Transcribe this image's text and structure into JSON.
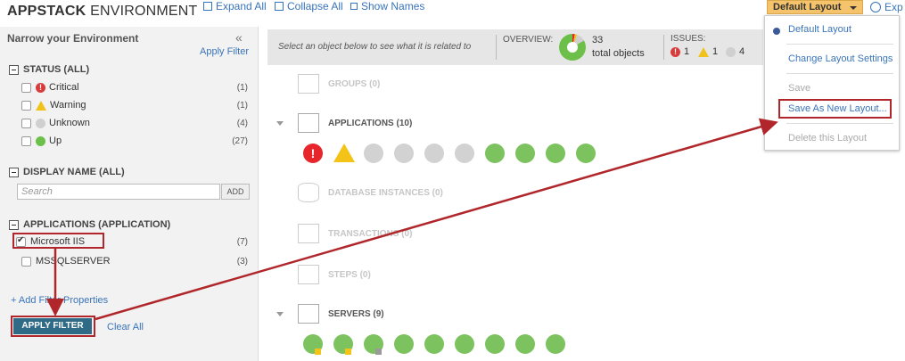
{
  "header": {
    "title_bold": "APPSTACK",
    "title_rest": " ENVIRONMENT",
    "links": {
      "expand_all": "Expand All",
      "collapse_all": "Collapse All",
      "show_names": "Show Names"
    },
    "layout_button": "Default Layout",
    "export_link": "Exp"
  },
  "sidebar": {
    "title": "Narrow your Environment",
    "collapse_glyph": "«",
    "apply_filter_link": "Apply Filter",
    "status": {
      "heading": "STATUS (ALL)",
      "items": [
        {
          "label": "Critical",
          "count": "(1)",
          "icon": "critical-icon"
        },
        {
          "label": "Warning",
          "count": "(1)",
          "icon": "warning-icon"
        },
        {
          "label": "Unknown",
          "count": "(4)",
          "icon": "unknown-icon"
        },
        {
          "label": "Up",
          "count": "(27)",
          "icon": "up-icon"
        }
      ]
    },
    "display_name": {
      "heading": "DISPLAY NAME (ALL)",
      "search_placeholder": "Search",
      "add_button": "ADD"
    },
    "applications": {
      "heading": "APPLICATIONS (APPLICATION)",
      "items": [
        {
          "label": "Microsoft IIS",
          "count": "(7)",
          "checked": true
        },
        {
          "label": "MSSQLSERVER",
          "count": "(3)",
          "checked": false
        }
      ]
    },
    "add_filter_properties": "+ Add Filter Properties",
    "apply_filter_button": "APPLY FILTER",
    "clear_all": "Clear All"
  },
  "overview": {
    "hint": "Select an object below to see what it is related to",
    "overview_label": "OVERVIEW:",
    "total_count": "33",
    "total_label": "total objects",
    "issues_label": "ISSUES:",
    "issue_counts": {
      "critical": "1",
      "warning": "1",
      "unknown": "4"
    }
  },
  "groups": [
    {
      "label": "GROUPS (0)",
      "icon": "folder-icon",
      "dim": true
    },
    {
      "label": "APPLICATIONS (10)",
      "icon": "window-icon",
      "dim": false
    },
    {
      "label": "DATABASE INSTANCES (0)",
      "icon": "database-icon",
      "dim": true
    },
    {
      "label": "TRANSACTIONS (0)",
      "icon": "tv-icon",
      "dim": true
    },
    {
      "label": "STEPS (0)",
      "icon": "film-icon",
      "dim": true
    },
    {
      "label": "SERVERS (9)",
      "icon": "server-icon",
      "dim": false
    }
  ],
  "applications_nodes": [
    "critical",
    "warning",
    "unknown",
    "unknown",
    "unknown",
    "unknown",
    "up",
    "up",
    "up",
    "up"
  ],
  "servers_nodes": [
    "up",
    "up",
    "up",
    "up",
    "up",
    "up",
    "up",
    "up",
    "up"
  ],
  "dropdown": {
    "items": [
      {
        "label": "Default Layout",
        "selected": true,
        "enabled": true
      },
      {
        "label": "Change Layout Settings",
        "enabled": true
      },
      {
        "label": "Save",
        "enabled": false
      },
      {
        "label": "Save As New Layout...",
        "enabled": true
      },
      {
        "label": "Delete this Layout",
        "enabled": false
      }
    ]
  },
  "colors": {
    "critical": "#e6262b",
    "warning": "#f3c318",
    "unknown": "#d2d2d2",
    "up": "#7cc35f",
    "highlight": "#b0262b",
    "link": "#3a74b8",
    "apply_button": "#2f6b86"
  }
}
